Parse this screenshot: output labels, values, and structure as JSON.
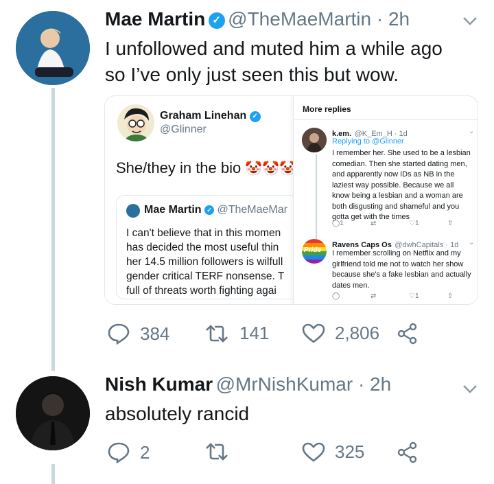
{
  "tweet1": {
    "name": "Mae Martin",
    "handle": "@TheMaeMartin · 2h",
    "text_line1": "I unfollowed and muted him a while ago",
    "text_line2": "so I’ve only just seen this but wow.",
    "replies": "384",
    "retweets": "141",
    "likes": "2,806"
  },
  "quoted": {
    "name": "Graham Linehan",
    "handle": "@Glinner",
    "text": "She/they in the bio",
    "clowns": "🤡🤡🤡",
    "inner": {
      "name": "Mae Martin",
      "handle": "@TheMaeMar",
      "lines": [
        "I can't believe that in this momen",
        "has decided the most useful thin",
        "her 14.5 million followers is wilfull",
        "gender critical TERF nonsense. T",
        "full of threats worth fighting agai"
      ]
    }
  },
  "more_replies": {
    "title": "More replies",
    "replies": [
      {
        "name": "k.em.",
        "handle": "@K_Em_H · 1d",
        "replying": "Replying to @Glinner",
        "lines": [
          "I remember her. She used to be a lesbian",
          "comedian. Then she started dating men,",
          "and apparently now IDs as NB in the",
          "laziest way possible. Because we all",
          "know being a lesbian and a woman are",
          "both disgusting and shameful and you",
          "gotta get with the times"
        ],
        "reply_count": "1",
        "like_count": "1"
      },
      {
        "name": "Ravens Caps Os",
        "handle": "@dwhCapitals · 1d",
        "avatar_text": "Pride",
        "lines": [
          "I remember scrolling on Netflix and my",
          "girlfriend told me not to watch her show",
          "because she's a fake lesbian and actually",
          "dates men."
        ],
        "like_count": "1"
      }
    ]
  },
  "tweet2": {
    "name": "Nish Kumar",
    "handle": "@MrNishKumar · 2h",
    "text": "absolutely rancid",
    "replies": "2",
    "likes": "325"
  },
  "colors": {
    "accent": "#1da1f2",
    "muted": "#657786",
    "border": "#e1e8ed",
    "thread": "#ccd6dd"
  }
}
